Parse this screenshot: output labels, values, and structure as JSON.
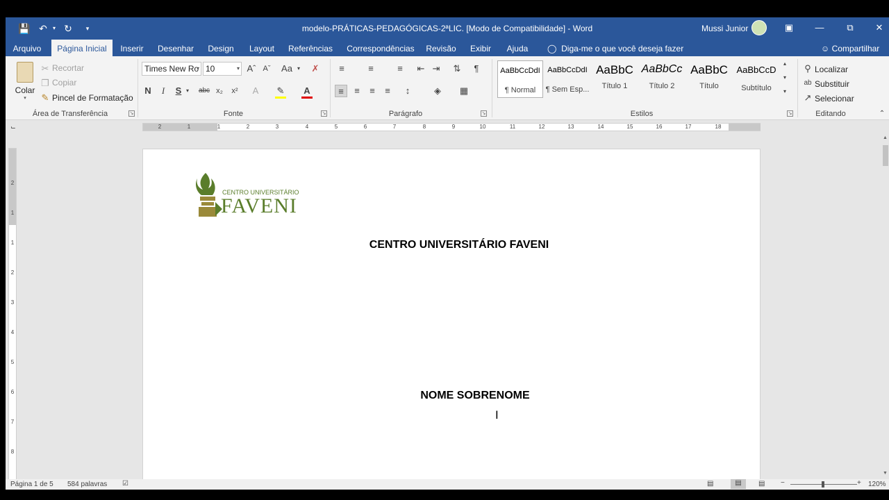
{
  "title_bar": {
    "document_title": "modelo-PRÁTICAS-PEDAGÓGICAS-2ªLIC. [Modo de Compatibilidade]  -  Word",
    "user_name": "Mussi Junior",
    "icons": [
      "save-icon",
      "undo-icon",
      "redo-icon",
      "customize-icon",
      "ribbon-display-icon",
      "minimize-icon",
      "restore-icon",
      "close-icon"
    ]
  },
  "tabs": [
    "Arquivo",
    "Página Inicial",
    "Inserir",
    "Desenhar",
    "Design",
    "Layout",
    "Referências",
    "Correspondências",
    "Revisão",
    "Exibir",
    "Ajuda"
  ],
  "active_tab": "Página Inicial",
  "tell_me": "Diga-me o que você deseja fazer",
  "share": "Compartilhar",
  "ribbon": {
    "clipboard": {
      "paste": "Colar",
      "cut": "Recortar",
      "copy": "Copiar",
      "format_painter": "Pincel de Formatação",
      "label": "Área de Transferência"
    },
    "font": {
      "name": "Times New Ro",
      "size": "10",
      "label": "Fonte",
      "bold": "N",
      "italic": "I",
      "underline": "S",
      "strike": "abc",
      "subscript": "x₂",
      "superscript": "x²",
      "case": "Aa"
    },
    "paragraph": {
      "label": "Parágrafo"
    },
    "styles": {
      "label": "Estilos",
      "items": [
        {
          "sample": "AaBbCcDdI",
          "name": "¶ Normal"
        },
        {
          "sample": "AaBbCcDdI",
          "name": "¶ Sem Esp..."
        },
        {
          "sample": "AaBbC",
          "name": "Título 1"
        },
        {
          "sample": "AaBbCc",
          "name": "Título 2"
        },
        {
          "sample": "AaBbC",
          "name": "Título"
        },
        {
          "sample": "AaBbCcD",
          "name": "Subtítulo"
        }
      ]
    },
    "editing": {
      "find": "Localizar",
      "replace": "Substituir",
      "select": "Selecionar",
      "label": "Editando"
    }
  },
  "ruler": {
    "horizontal_numbers": [
      "2",
      "1",
      "1",
      "2",
      "3",
      "4",
      "5",
      "6",
      "7",
      "8",
      "9",
      "10",
      "11",
      "12",
      "13",
      "14",
      "15",
      "16",
      "17",
      "18"
    ],
    "vertical_numbers": [
      "2",
      "1",
      "1",
      "2",
      "3",
      "4",
      "5",
      "6",
      "7",
      "8"
    ]
  },
  "document": {
    "logo_small": "CENTRO UNIVERSITÁRIO",
    "logo_big": "FAVENI",
    "heading": "CENTRO UNIVERSITÁRIO FAVENI",
    "author": "NOME SOBRENOME"
  },
  "status": {
    "page": "Página 1 de 5",
    "words": "584 palavras",
    "zoom": "120%"
  },
  "colors": {
    "title_bar": "#2b579a",
    "logo_green": "#5a7d2b",
    "logo_gold": "#9a8a3a"
  }
}
